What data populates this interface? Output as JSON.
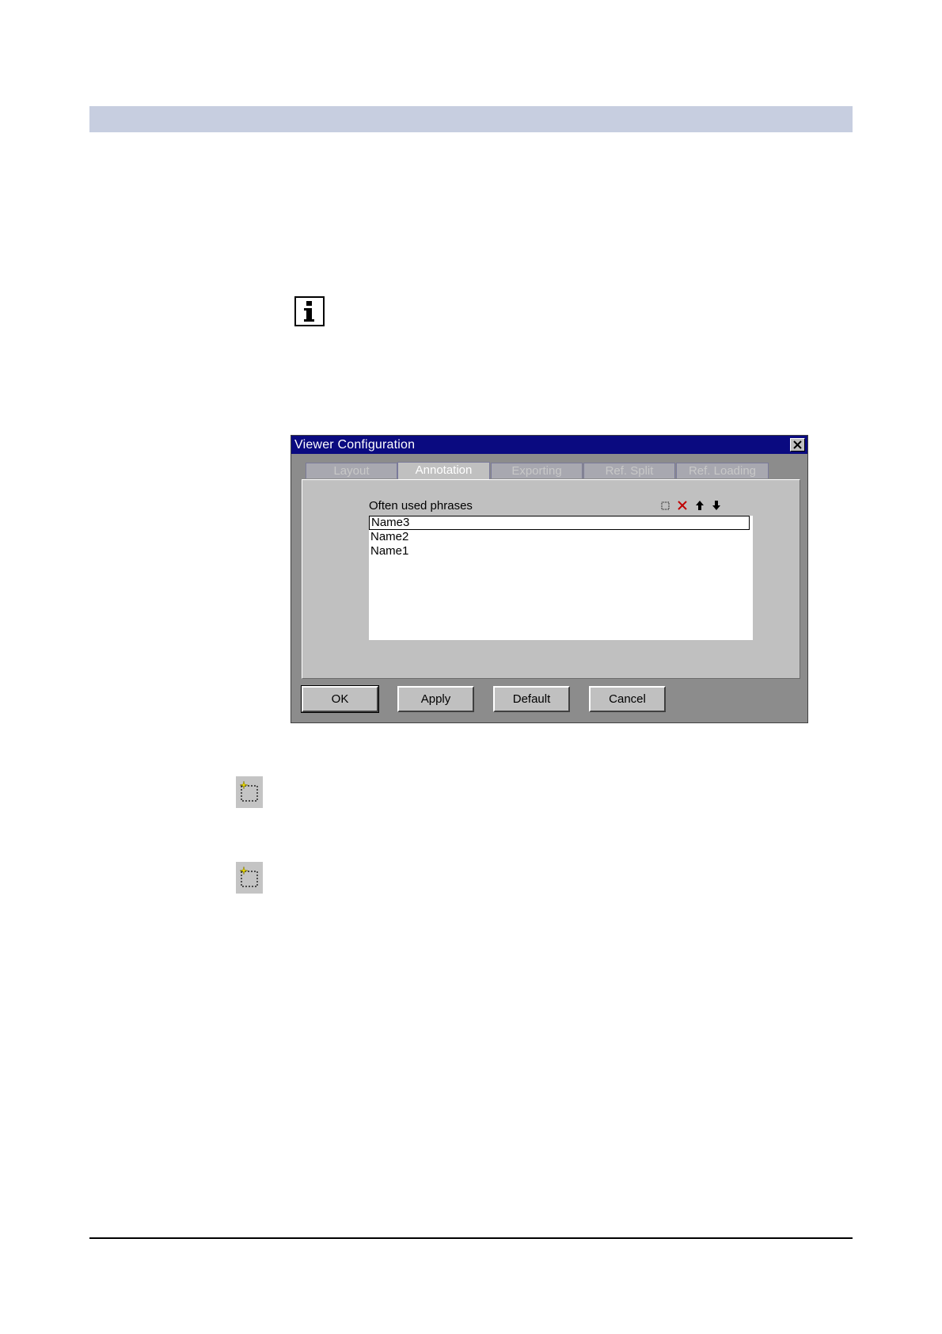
{
  "dialog": {
    "title": "Viewer Configuration",
    "tabs": [
      {
        "label": "Layout",
        "active": false
      },
      {
        "label": "Annotation",
        "active": true
      },
      {
        "label": "Exporting",
        "active": false
      },
      {
        "label": "Ref. Split",
        "active": false
      },
      {
        "label": "Ref. Loading",
        "active": false
      }
    ],
    "panel": {
      "label": "Often used phrases",
      "toolbar_icons": [
        "new-icon",
        "delete-icon",
        "arrow-up-icon",
        "arrow-down-icon"
      ],
      "items": [
        "Name3",
        "Name2",
        "Name1"
      ]
    },
    "buttons": {
      "ok": "OK",
      "apply": "Apply",
      "default": "Default",
      "cancel": "Cancel"
    }
  },
  "icons": {
    "info": "info-icon",
    "new_phrase_1": "new-item-icon",
    "new_phrase_2": "new-item-icon"
  },
  "colors": {
    "header_band": "#c7cee0",
    "titlebar": "#0a0a80",
    "delete_icon": "#c00000"
  }
}
